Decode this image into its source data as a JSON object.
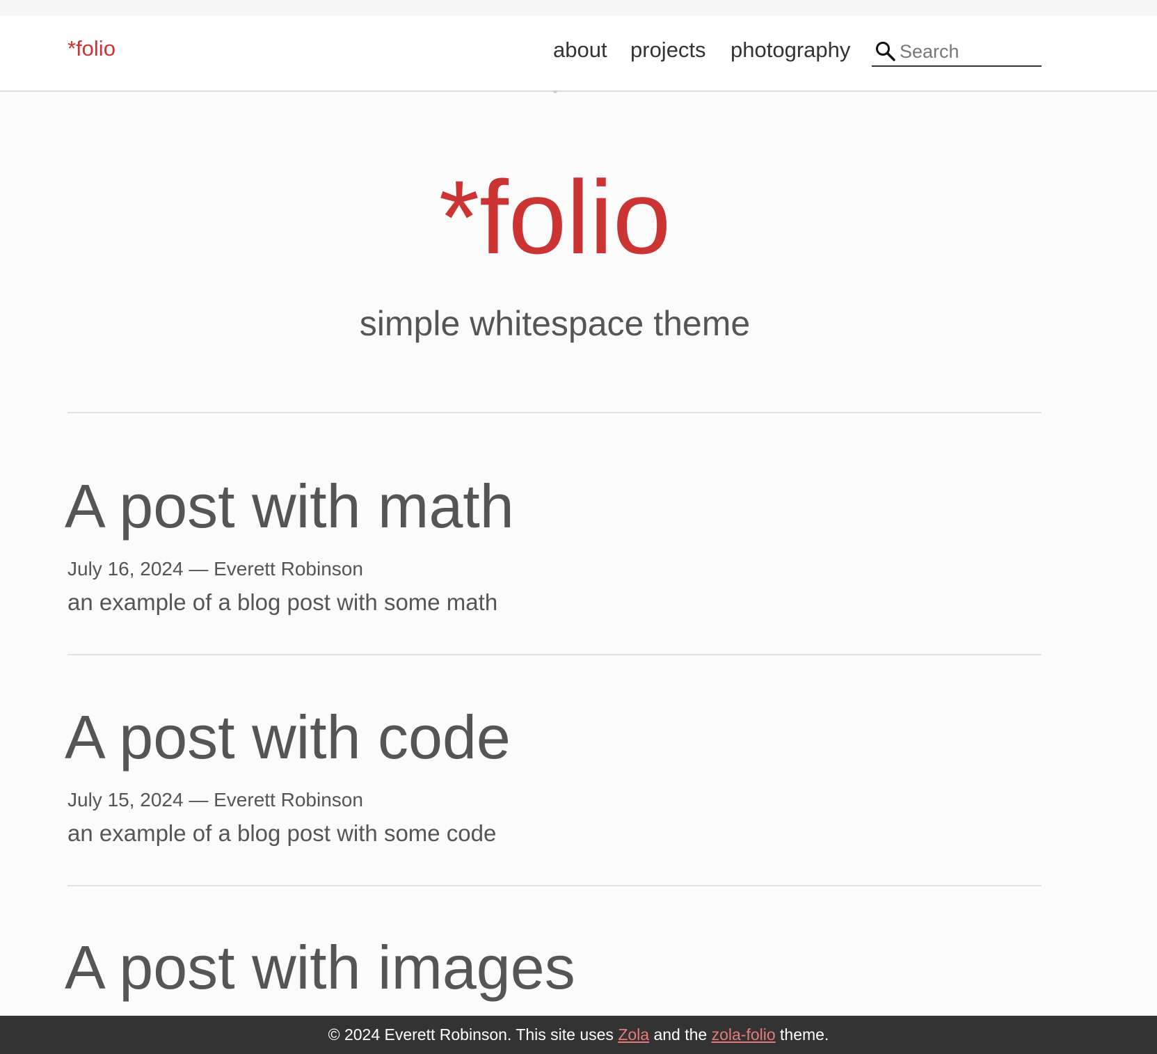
{
  "header": {
    "brand": "*folio",
    "nav": [
      {
        "label": "about"
      },
      {
        "label": "projects"
      },
      {
        "label": "photography"
      }
    ],
    "search": {
      "placeholder": "Search",
      "icon": "search-icon"
    }
  },
  "hero": {
    "title": "*folio",
    "subtitle": "simple whitespace theme"
  },
  "posts": [
    {
      "title": "A post with math",
      "meta": "July 16, 2024 — Everett Robinson",
      "summary": "an example of a blog post with some math"
    },
    {
      "title": "A post with code",
      "meta": "July 15, 2024 — Everett Robinson",
      "summary": "an example of a blog post with some code"
    },
    {
      "title": "A post with images"
    }
  ],
  "footer": {
    "prefix": "© 2024 Everett Robinson. This site uses",
    "link1": "Zola",
    "middle": "and the",
    "link2": "zola-folio",
    "suffix": "theme."
  },
  "colors": {
    "accent": "#cc3333",
    "text": "#555555",
    "footer_bg": "#333333",
    "footer_link": "#e87a7a",
    "background": "#fbfbfb"
  }
}
